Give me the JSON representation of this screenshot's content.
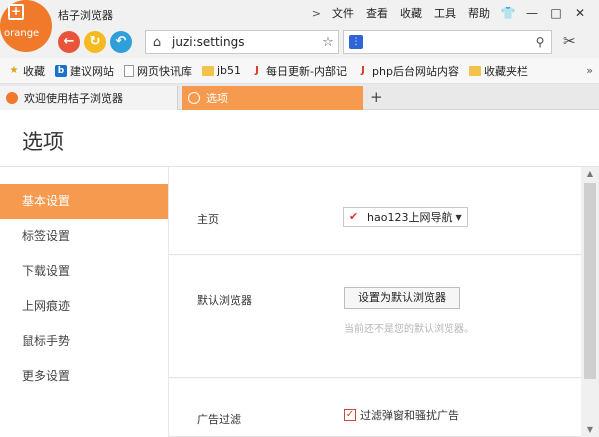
{
  "window": {
    "title": "桔子浏览器",
    "logo_text": "orange",
    "menu": [
      "文件",
      "查看",
      "收藏",
      "工具",
      "帮助"
    ]
  },
  "nav": {
    "address": "juzi:settings",
    "search_placeholder": ""
  },
  "bookmarks": [
    {
      "label": "收藏",
      "icon": "star-icon"
    },
    {
      "label": "建议网站",
      "icon": "bing-icon"
    },
    {
      "label": "网页快讯库",
      "icon": "page-icon"
    },
    {
      "label": "jb51",
      "icon": "folder-icon"
    },
    {
      "label": "每日更新-内部记",
      "icon": "jb-icon"
    },
    {
      "label": "php后台网站内容",
      "icon": "jb-icon"
    },
    {
      "label": "收藏夹栏",
      "icon": "folder-icon"
    }
  ],
  "tabs": [
    {
      "label": "欢迎使用桔子浏览器",
      "active": false
    },
    {
      "label": "选项",
      "active": true
    }
  ],
  "page": {
    "title": "选项",
    "sidebar": [
      "基本设置",
      "标签设置",
      "下载设置",
      "上网痕迹",
      "鼠标手势",
      "更多设置"
    ],
    "active_index": 0,
    "homepage": {
      "label": "主页",
      "value": "hao123上网导航"
    },
    "default_browser": {
      "label": "默认浏览器",
      "button": "设置为默认浏览器",
      "note": "当前还不是您的默认浏览器。"
    },
    "ad_filter": {
      "label": "广告过滤",
      "checkbox_label": "过滤弹窗和骚扰广告",
      "checked": true
    }
  },
  "colors": {
    "accent": "#f59a4e",
    "logo": "#f07a2a",
    "back_button": "#e8553b",
    "refresh_button": "#f5b921",
    "restore_button": "#2e9fd8"
  }
}
